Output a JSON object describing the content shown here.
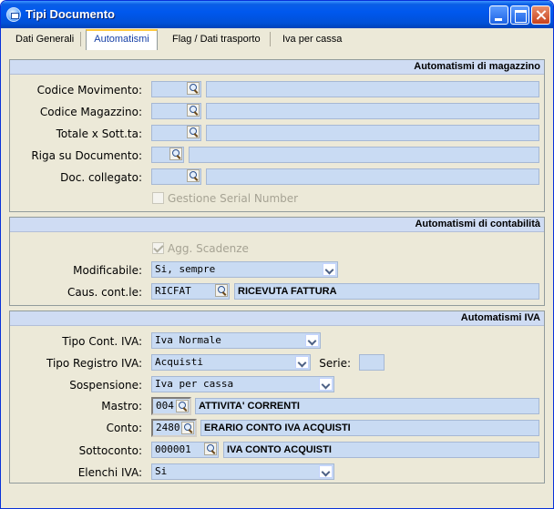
{
  "window": {
    "title": "Tipi Documento"
  },
  "tabs": [
    {
      "label": "Dati Generali"
    },
    {
      "label": "Automatismi"
    },
    {
      "label": "Flag / Dati trasporto"
    },
    {
      "label": "Iva per cassa"
    }
  ],
  "magazzino": {
    "header": "Automatismi di magazzino",
    "codice_movimento": {
      "label": "Codice Movimento:",
      "code": "",
      "desc": ""
    },
    "codice_magazzino": {
      "label": "Codice Magazzino:",
      "code": "",
      "desc": ""
    },
    "totale_sotttotale": {
      "label": "Totale x Sott.ta:",
      "code": "",
      "desc": ""
    },
    "riga_documento": {
      "label": "Riga su Documento:",
      "code": "",
      "desc": ""
    },
    "doc_collegato": {
      "label": "Doc. collegato:",
      "code": "",
      "desc": ""
    },
    "serial_number": {
      "label": "Gestione Serial Number",
      "checked": false
    }
  },
  "contabilita": {
    "header": "Automatismi di contabilità",
    "agg_scadenze": {
      "label": "Agg. Scadenze",
      "checked": true
    },
    "modificabile": {
      "label": "Modificabile:",
      "value": "Si, sempre"
    },
    "caus_cont": {
      "label": "Caus. cont.le:",
      "code": "RICFAT",
      "desc": "RICEVUTA FATTURA"
    }
  },
  "iva": {
    "header": "Automatismi IVA",
    "tipo_cont": {
      "label": "Tipo Cont. IVA:",
      "value": "Iva Normale"
    },
    "tipo_registro": {
      "label": "Tipo Registro IVA:",
      "value": "Acquisti"
    },
    "serie": {
      "label": "Serie:",
      "value": ""
    },
    "sospensione": {
      "label": "Sospensione:",
      "value": "Iva per cassa"
    },
    "mastro": {
      "label": "Mastro:",
      "code": "004",
      "desc": "ATTIVITA' CORRENTI"
    },
    "conto": {
      "label": "Conto:",
      "code": "2480",
      "desc": "ERARIO CONTO IVA ACQUISTI"
    },
    "sottoconto": {
      "label": "Sottoconto:",
      "code": "000001",
      "desc": "IVA CONTO ACQUISTI"
    },
    "elenchi": {
      "label": "Elenchi IVA:",
      "value": "Si"
    }
  }
}
